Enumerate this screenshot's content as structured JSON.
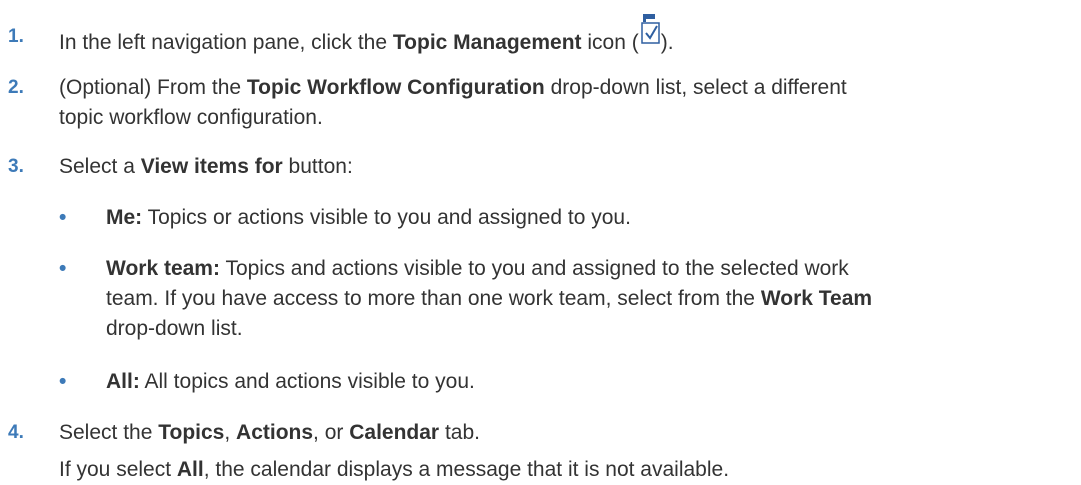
{
  "steps": [
    {
      "number": "1.",
      "parts": [
        "In the left navigation pane, click the ",
        "Topic Management",
        " icon (",
        ")."
      ]
    },
    {
      "number": "2.",
      "parts": [
        "(Optional) From the ",
        "Topic Workflow Configuration",
        " drop-down list, select a different",
        "topic workflow configuration."
      ]
    },
    {
      "number": "3.",
      "parts": [
        "Select a ",
        "View items for",
        " button:"
      ],
      "bullets": [
        {
          "term": "Me:",
          "lines": [
            " Topics or actions visible to you and assigned to you."
          ]
        },
        {
          "term": "Work team:",
          "lines": [
            " Topics and actions visible to you and assigned to the selected work",
            "team. If you have access to more than one work team, select from the ",
            "drop-down list."
          ],
          "bold_inline": "Work Team"
        },
        {
          "term": "All:",
          "lines": [
            " All topics and actions visible to you."
          ]
        }
      ]
    },
    {
      "number": "4.",
      "parts": [
        "Select the ",
        "Topics",
        ", ",
        "Actions",
        ", or ",
        "Calendar",
        " tab."
      ],
      "note": [
        "If you select ",
        "All",
        ", the calendar displays a message that it is not available."
      ]
    }
  ],
  "colors": {
    "number": "#3d7ab8",
    "text": "#333333",
    "icon": "#2f5fa0"
  },
  "icons": {
    "topic_management": "topic-management-icon"
  }
}
